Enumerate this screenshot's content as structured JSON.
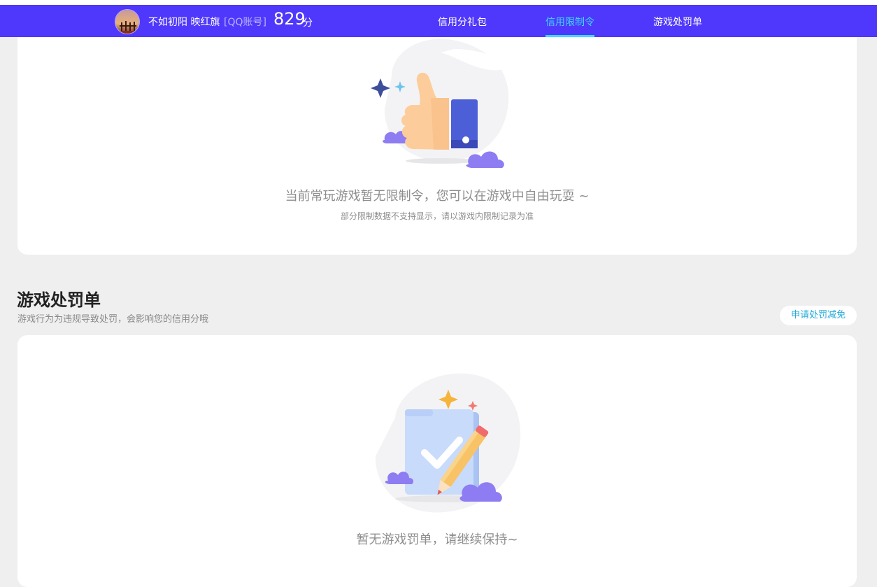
{
  "header": {
    "user_name": "不如初阳 映红旗",
    "account_type": "[QQ账号]",
    "score": "829",
    "score_unit": "分",
    "tabs": [
      {
        "label": "信用分礼包",
        "active": false
      },
      {
        "label": "信用限制令",
        "active": true
      },
      {
        "label": "游戏处罚单",
        "active": false
      }
    ],
    "colors": {
      "nav_bg": "#4f38fb",
      "active_tab": "#3fd8ff"
    }
  },
  "restriction": {
    "empty_title": "当前常玩游戏暂无限制令，您可以在游戏中自由玩耍 ~",
    "empty_note": "部分限制数据不支持显示，请以游戏内限制记录为准",
    "illustration": "thumbs-up-illustration"
  },
  "penalty": {
    "section_title": "游戏处罚单",
    "section_desc": "游戏行为为违规导致处罚，会影响您的信用分哦",
    "appeal_button": "申请处罚减免",
    "empty_title": "暂无游戏罚单，请继续保持~",
    "illustration": "document-check-illustration"
  }
}
